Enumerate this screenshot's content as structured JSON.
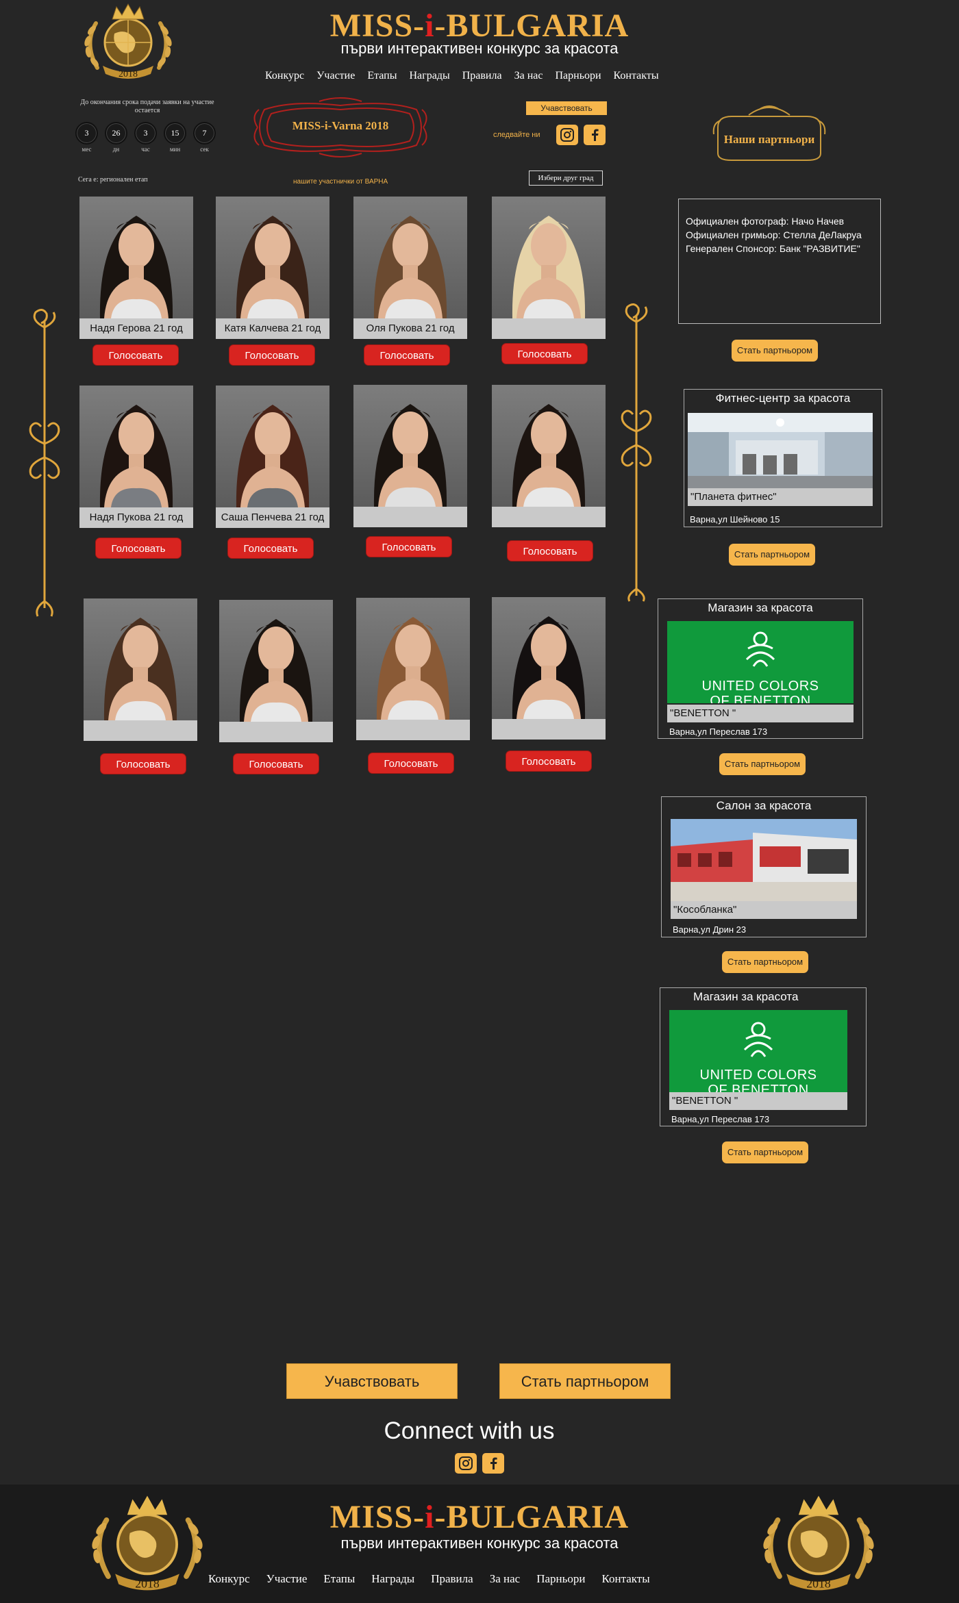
{
  "brand": {
    "title_pre": "MISS-",
    "title_i": "i",
    "title_post": "-BULGARIA",
    "subtitle": "първи интерактивен конкурс за красота",
    "emblem_year": "2018"
  },
  "nav": [
    "Конкурс",
    "Участие",
    "Етапы",
    "Награды",
    "Правила",
    "За нас",
    "Парньори",
    "Контакты"
  ],
  "countdown": {
    "title": "До окончания срока подачи заявки на участие остается",
    "cells": [
      {
        "value": "3",
        "unit": "мес"
      },
      {
        "value": "26",
        "unit": "дн"
      },
      {
        "value": "3",
        "unit": "час"
      },
      {
        "value": "15",
        "unit": "мин"
      },
      {
        "value": "7",
        "unit": "сек"
      }
    ]
  },
  "plaque": "MISS-i-Varna 2018",
  "participate_btn": "Учавствовать",
  "follow_label": "следвайте ни",
  "partners_badge": "Наши партньори",
  "stage_text": "Сега е: регионален етап",
  "our_participants": "нашите участнички от ВАРНА",
  "choose_city": "Избери друг град",
  "contestants": [
    {
      "name": "Надя Герова 21 год",
      "vote": "Голосовать"
    },
    {
      "name": "Катя  Калчева 21 год",
      "vote": "Голосовать"
    },
    {
      "name": "Оля  Пукова 21 год",
      "vote": "Голосовать"
    },
    {
      "name": "",
      "vote": "Голосовать"
    },
    {
      "name": "Надя  Пукова 21 год",
      "vote": "Голосовать"
    },
    {
      "name": "Саша Пенчева 21 год",
      "vote": "Голосовать"
    },
    {
      "name": "",
      "vote": "Голосовать"
    },
    {
      "name": "",
      "vote": "Голосовать"
    },
    {
      "name": "",
      "vote": "Голосовать"
    },
    {
      "name": "",
      "vote": "Голосовать"
    },
    {
      "name": "",
      "vote": "Голосовать"
    },
    {
      "name": "",
      "vote": "Голосовать"
    }
  ],
  "sponsors": {
    "lines": [
      "Официален фотограф: Начо Начев",
      "Официален гримьор: Стелла ДеЛакруа",
      "Генерален Спонсор: Банк \"РАЗВИТИЕ\""
    ]
  },
  "become_partner": "Стать партньором",
  "partners": [
    {
      "category": "Фитнес-центр за красота",
      "name": "\"Планета фитнес\"",
      "address": "Варна,ул Шейново 15",
      "image": "fitness-interior"
    },
    {
      "category": "Магазин за красота",
      "name": "\"BENETTON \"",
      "address": "Варна,ул Переслав 173",
      "image": "benetton-logo",
      "logo_line1": "UNITED COLORS",
      "logo_line2": "OF BENETTON"
    },
    {
      "category": "Салон за красота",
      "name": "\"Кособланка\"",
      "address": "Варна,ул Дрин 23",
      "image": "salon-building"
    },
    {
      "category": "Магазин за красота",
      "name": "\"BENETTON \"",
      "address": "Варна,ул Переслав 173",
      "image": "benetton-logo",
      "logo_line1": "UNITED COLORS",
      "logo_line2": "OF BENETTON"
    }
  ],
  "cta": {
    "participate": "Учавствовать",
    "partner": "Стать партньором"
  },
  "connect": "Connect with us",
  "footer": {
    "nav": [
      "Конкурс",
      "Участие",
      "Етапы",
      "Награды",
      "Правила",
      "За нас",
      "Парньори",
      "Контакты"
    ]
  },
  "colors": {
    "background": "#262626",
    "gold": "#f1b24a",
    "button_gold": "#f6b64c",
    "vote_red": "#d82420",
    "name_bar": "#c9c9c9",
    "footer_bg": "#1b1b1b"
  },
  "icons": [
    "crown-globe-emblem",
    "instagram-icon",
    "facebook-icon",
    "scroll-ornament"
  ]
}
